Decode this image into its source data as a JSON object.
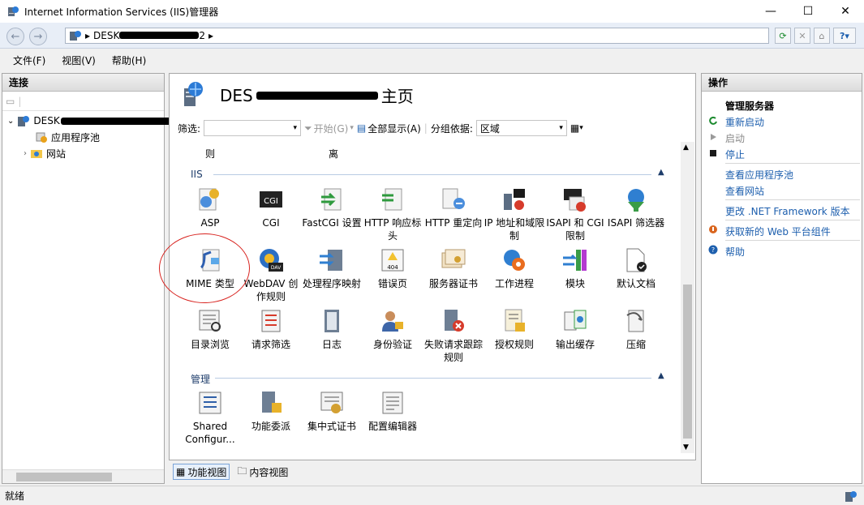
{
  "window": {
    "title": "Internet Information Services (IIS)管理器"
  },
  "window_controls": {
    "minimize": "—",
    "maximize": "☐",
    "close": "✕"
  },
  "address": {
    "host_prefix": "DESK",
    "host_suffix": "2",
    "separator": "▸"
  },
  "menu": [
    "文件(F)",
    "视图(V)",
    "帮助(H)"
  ],
  "connections": {
    "title": "连接",
    "server_prefix": "DESK",
    "items": [
      "应用程序池",
      "网站"
    ]
  },
  "center": {
    "title_prefix": "DES",
    "title_suffix": "主页",
    "filter_label": "筛选:",
    "start_label": "开始(G)",
    "show_all_label": "全部显示(A)",
    "group_label": "分组依据:",
    "group_value": "区域",
    "partial_row": [
      "则",
      "离"
    ],
    "sections": {
      "iis": "IIS",
      "management": "管理"
    },
    "iis_row1": [
      "ASP",
      "CGI",
      "FastCGI 设置",
      "HTTP 响应标头",
      "HTTP 重定向",
      "IP 地址和域限制",
      "ISAPI 和 CGI 限制",
      "ISAPI 筛选器"
    ],
    "iis_row2": [
      "MIME 类型",
      "WebDAV 创作规则",
      "处理程序映射",
      "错误页",
      "服务器证书",
      "工作进程",
      "模块",
      "默认文档"
    ],
    "iis_row3": [
      "目录浏览",
      "请求筛选",
      "日志",
      "身份验证",
      "失败请求跟踪规则",
      "授权规则",
      "输出缓存",
      "压缩"
    ],
    "mgmt_row": [
      "Shared Configur...",
      "功能委派",
      "集中式证书",
      "配置编辑器"
    ]
  },
  "view_tabs": {
    "features": "功能视图",
    "content": "内容视图"
  },
  "actions": {
    "title": "操作",
    "manage_server": "管理服务器",
    "restart": "重新启动",
    "start": "启动",
    "stop": "停止",
    "view_app_pools": "查看应用程序池",
    "view_sites": "查看网站",
    "change_net": "更改 .NET Framework 版本",
    "get_web_platform": "获取新的 Web 平台组件",
    "help": "帮助"
  },
  "status": {
    "text": "就绪"
  },
  "colors": {
    "accent_link": "#1d5fae",
    "annotation_circle": "#d8231f"
  }
}
